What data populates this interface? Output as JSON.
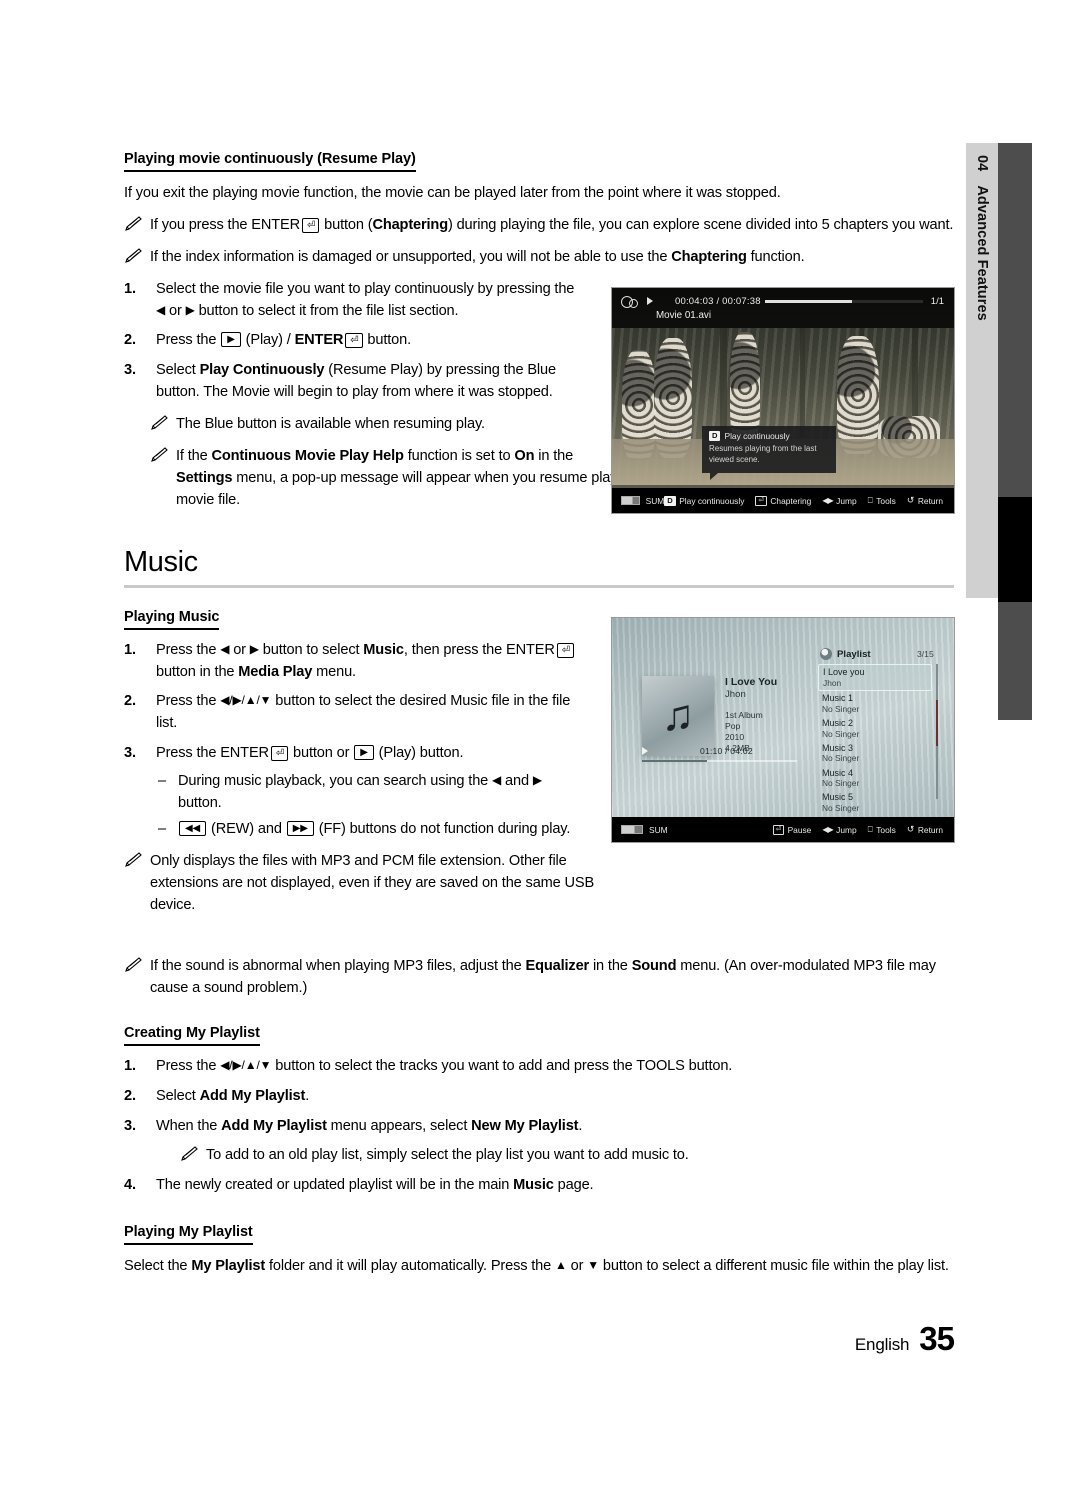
{
  "side_tab": {
    "number": "04",
    "label": "Advanced Features"
  },
  "footer": {
    "language": "English",
    "page_number": "35"
  },
  "resume": {
    "heading": "Playing movie continuously (Resume Play)",
    "intro": "If you exit the playing movie function, the movie can be played later from the point where it was stopped.",
    "note1_a": "If you press the ENTER",
    "note1_b": "button (",
    "note1_bold": "Chaptering",
    "note1_c": ") during playing the file, you can explore scene divided into 5 chapters you want.",
    "note2_a": "If the index information is damaged or unsupported, you will not be able to use the ",
    "note2_bold": "Chaptering",
    "note2_b": " function.",
    "steps": [
      {
        "num": "1.",
        "text_a": "Select the movie file you want to play continuously by pressing the ",
        "text_b": " or ",
        "text_c": " button to select it from the file list section."
      },
      {
        "num": "2.",
        "text_a": "Press the ",
        "text_b": " (Play) / ",
        "text_c": "ENTER",
        "text_d": " button."
      },
      {
        "num": "3.",
        "text_a": "Select ",
        "bold": "Play Continuously",
        "text_b": " (Resume Play) by pressing the Blue button. The Movie will begin to play from where it was stopped."
      }
    ],
    "note3": "The Blue button is available when resuming play.",
    "note4_a": "If the ",
    "note4_bold1": "Continuous Movie Play Help",
    "note4_b": " function is set to ",
    "note4_bold2": "On",
    "note4_c": " in the ",
    "note4_bold3": "Settings",
    "note4_d": " menu, a pop-up message will appear when you resume play a movie file."
  },
  "movie_shot": {
    "time_current": "00:04:03",
    "time_separator": "/",
    "time_total": "00:07:38",
    "page_indicator": "1/1",
    "file_name": "Movie 01.avi",
    "popup_badge": "D",
    "popup_title": "Play continuously",
    "popup_body": "Resumes playing from the last viewed scene.",
    "source_label": "SUM",
    "bottom_items": [
      {
        "badge": "D",
        "label": "Play continuously"
      },
      {
        "icon": "enter-icon",
        "label": "Chaptering"
      },
      {
        "icon": "left-right-icon",
        "label": "Jump"
      },
      {
        "icon": "tools-icon",
        "label": "Tools"
      },
      {
        "icon": "return-icon",
        "label": "Return"
      }
    ]
  },
  "music_section": {
    "title": "Music",
    "playing_music_heading": "Playing Music",
    "steps": [
      {
        "num": "1.",
        "a": "Press the ",
        "b": " or ",
        "c": " button to select ",
        "bold1": "Music",
        "d": ", then press the ",
        "e": "ENTER",
        "f": " button in the ",
        "bold2": "Media Play",
        "g": " menu."
      },
      {
        "num": "2.",
        "a": "Press the ",
        "b": " button to select the desired Music file in the file list."
      },
      {
        "num": "3.",
        "a": "Press the ",
        "b": "ENTER",
        "c": " button or ",
        "d": " (Play) button."
      }
    ],
    "dashes": [
      {
        "a": "During music playback, you can search using the ",
        "b": " and ",
        "c": " button."
      },
      {
        "a": " (REW) and ",
        "b": " (FF) buttons do not function during play."
      }
    ],
    "note_mp3": "Only displays the files with MP3 and PCM file extension. Other file extensions are not displayed, even if they are saved on the same USB device.",
    "note_eq_a": "If the sound is abnormal when playing MP3 files, adjust the ",
    "note_eq_bold1": "Equalizer",
    "note_eq_b": " in the ",
    "note_eq_bold2": "Sound",
    "note_eq_c": " menu. (An over-modulated MP3 file may cause a sound problem.)"
  },
  "music_shot": {
    "now_playing_title": "I Love You",
    "now_playing_artist": "Jhon",
    "album": "1st Album",
    "genre": "Pop",
    "year": "2010",
    "size": "4.2MB",
    "playlist_label": "Playlist",
    "playlist_count": "3/15",
    "playlist": [
      {
        "title": "I Love you",
        "artist": "Jhon",
        "selected": true
      },
      {
        "title": "Music 1",
        "artist": "No Singer",
        "selected": false
      },
      {
        "title": "Music 2",
        "artist": "No Singer",
        "selected": false
      },
      {
        "title": "Music 3",
        "artist": "No Singer",
        "selected": false
      },
      {
        "title": "Music 4",
        "artist": "No Singer",
        "selected": false
      },
      {
        "title": "Music 5",
        "artist": "No Singer",
        "selected": false
      }
    ],
    "time_current": "01:10",
    "time_separator": "/",
    "time_total": "04:02",
    "source_label": "SUM",
    "bottom_items": [
      {
        "icon": "enter-icon",
        "label": "Pause"
      },
      {
        "icon": "left-right-icon",
        "label": "Jump"
      },
      {
        "icon": "tools-icon",
        "label": "Tools"
      },
      {
        "icon": "return-icon",
        "label": "Return"
      }
    ]
  },
  "creating_playlist": {
    "heading": "Creating My Playlist",
    "steps": [
      {
        "num": "1.",
        "a": "Press the ",
        "b": " button to select the tracks you want to add and press the ",
        "bold": "TOOLS",
        "c": " button."
      },
      {
        "num": "2.",
        "a": "Select ",
        "bold": "Add My Playlist",
        "c": "."
      },
      {
        "num": "3.",
        "a": "When the ",
        "bold": "Add My Playlist",
        "b": " menu appears, select ",
        "bold2": "New My Playlist",
        "c": "."
      },
      {
        "num": "4.",
        "a": "The newly created or updated playlist will be in the main ",
        "bold": "Music",
        "c": " page."
      }
    ],
    "note_old_list": "To add to an old play list, simply select the play list you want to add music to."
  },
  "playing_playlist": {
    "heading": "Playing My Playlist",
    "a": "Select the ",
    "bold": "My Playlist",
    "b": " folder and it will play automatically. Press the ",
    "c": " or ",
    "d": " button to select a different music file within the play list."
  }
}
